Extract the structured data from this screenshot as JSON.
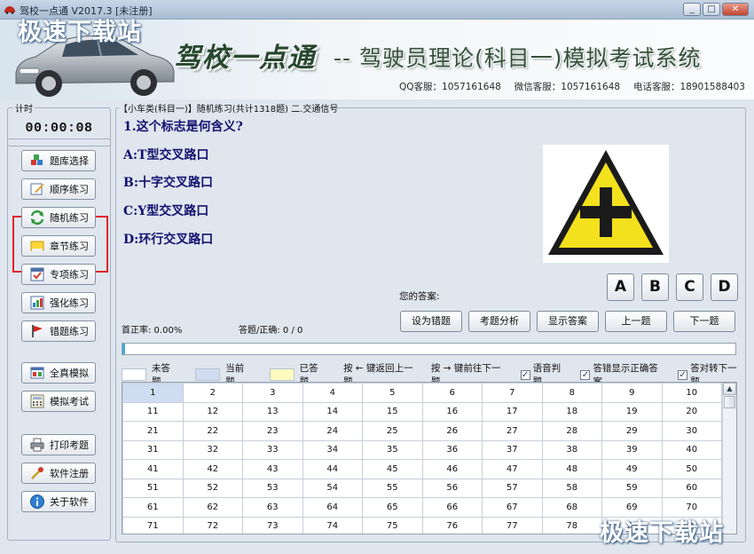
{
  "window": {
    "title": "驾校一点通 V2017.3 [未注册]"
  },
  "header": {
    "logo": "驾校一点通",
    "subtitle": "-- 驾驶员理论(科目一)模拟考试系统",
    "contacts": [
      "QQ客服：1057161648",
      "微信客服：1057161648",
      "电话客服：18901588403"
    ]
  },
  "watermark": "极速下载站",
  "timer": {
    "label": "计时",
    "value": "00:00:08"
  },
  "nav": [
    {
      "label": "题库选择",
      "icon": "database-icon"
    },
    {
      "label": "顺序练习",
      "icon": "edit-icon"
    },
    {
      "label": "随机练习",
      "icon": "shuffle-icon"
    },
    {
      "label": "章节练习",
      "icon": "note-icon"
    },
    {
      "label": "专项练习",
      "icon": "checklist-icon"
    },
    {
      "label": "强化练习",
      "icon": "bar-chart-icon"
    },
    {
      "label": "错题练习",
      "icon": "flag-icon"
    },
    {
      "label": "全真模拟",
      "icon": "window-icon"
    },
    {
      "label": "模拟考试",
      "icon": "calculator-icon"
    },
    {
      "label": "打印考题",
      "icon": "printer-icon"
    },
    {
      "label": "软件注册",
      "icon": "key-icon"
    },
    {
      "label": "关于软件",
      "icon": "info-icon"
    }
  ],
  "breadcrumb": "【小车类(科目一)】随机练习(共计1318题) 二.交通信号",
  "question": {
    "text": "1.这个标志是何含义?",
    "options": [
      "A:T型交叉路口",
      "B:十字交叉路口",
      "C:Y型交叉路口",
      "D:环行交叉路口"
    ],
    "sign_icon": "crossroad-warning-sign"
  },
  "answer": {
    "label": "您的答案:",
    "buttons": [
      "A",
      "B",
      "C",
      "D"
    ]
  },
  "stats": {
    "accuracy": "首正率: 0.00%",
    "progress": "答题/正确: 0 / 0"
  },
  "actions": [
    "设为错题",
    "考题分析",
    "显示答案",
    "上一题",
    "下一题"
  ],
  "progress_fraction": 0.004,
  "legend": {
    "unanswered": "未答题",
    "current": "当前题",
    "answered": "已答题",
    "hint_prev": "按 ← 键返回上一题",
    "hint_next": "按 → 键前往下一题",
    "colors": {
      "unanswered": "#ffffff",
      "current": "#cfdcf1",
      "answered": "#fffac0"
    }
  },
  "options": [
    {
      "label": "语音判题",
      "checked": true
    },
    {
      "label": "答错显示正确答案",
      "checked": true
    },
    {
      "label": "答对转下一题",
      "checked": true
    }
  ],
  "grid_rows": [
    [
      "1",
      "2",
      "3",
      "4",
      "5",
      "6",
      "7",
      "8",
      "9",
      "10"
    ],
    [
      "11",
      "12",
      "13",
      "14",
      "15",
      "16",
      "17",
      "18",
      "19",
      "20"
    ],
    [
      "21",
      "22",
      "23",
      "24",
      "25",
      "26",
      "27",
      "28",
      "29",
      "30"
    ],
    [
      "31",
      "32",
      "33",
      "34",
      "35",
      "36",
      "37",
      "38",
      "39",
      "40"
    ],
    [
      "41",
      "42",
      "43",
      "44",
      "45",
      "46",
      "47",
      "48",
      "49",
      "50"
    ],
    [
      "51",
      "52",
      "53",
      "54",
      "55",
      "56",
      "57",
      "58",
      "59",
      "60"
    ],
    [
      "61",
      "62",
      "63",
      "64",
      "65",
      "66",
      "67",
      "68",
      "69",
      "70"
    ],
    [
      "71",
      "72",
      "73",
      "74",
      "75",
      "76",
      "77",
      "78",
      "79",
      "80"
    ]
  ],
  "current_question": "1"
}
